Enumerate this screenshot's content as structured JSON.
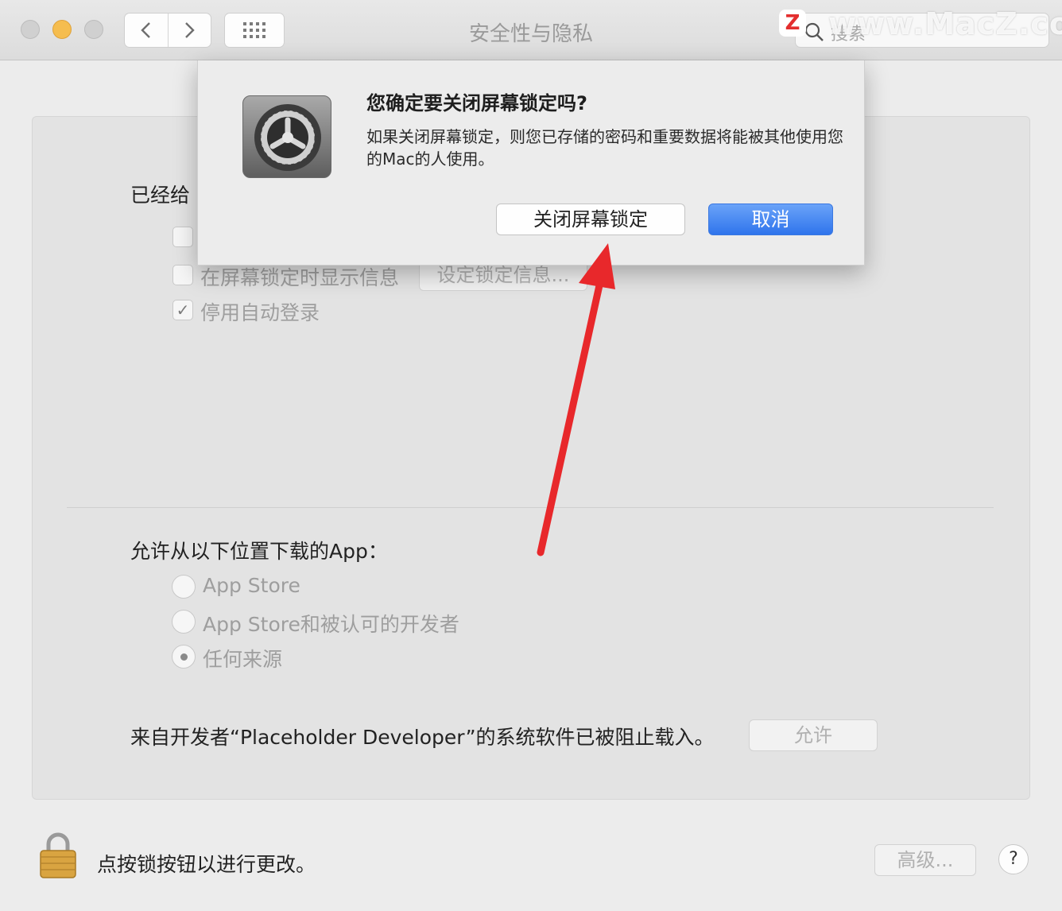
{
  "window": {
    "title": "安全性与隐私",
    "search_placeholder": "搜索",
    "watermark": "www.MacZ.com",
    "watermark_logo": "Z"
  },
  "general": {
    "heading_partial": "已经给",
    "show_message_label": "在屏幕锁定时显示信息",
    "set_lock_message_button": "设定锁定信息...",
    "disable_auto_login_label": "停用自动登录",
    "disable_auto_login_checked": true,
    "checkmark": "✓"
  },
  "downloads": {
    "heading": "允许从以下位置下载的App：",
    "options": [
      {
        "label": "App Store",
        "selected": false
      },
      {
        "label": "App Store和被认可的开发者",
        "selected": false
      },
      {
        "label": "任何来源",
        "selected": true
      }
    ]
  },
  "blocked": {
    "message": "来自开发者“Placeholder Developer”的系统软件已被阻止载入。",
    "allow_button": "允许"
  },
  "footer": {
    "lock_message": "点按锁按钮以进行更改。",
    "advanced_button": "高级...",
    "help_button": "?"
  },
  "dialog": {
    "title": "您确定要关闭屏幕锁定吗?",
    "message": "如果关闭屏幕锁定，则您已存储的密码和重要数据将能被其他使用您的Mac的人使用。",
    "confirm_button": "关闭屏幕锁定",
    "cancel_button": "取消"
  },
  "colors": {
    "accent_blue": "#2f74ec",
    "annotation_arrow": "#e8282b",
    "lock_gold": "#d9a441"
  }
}
